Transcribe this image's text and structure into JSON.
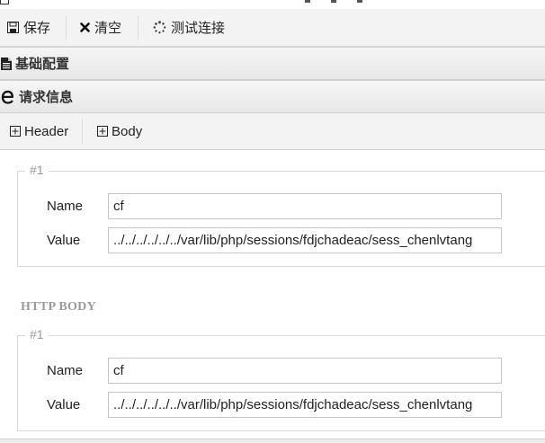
{
  "toolbar": {
    "save_label": "保存",
    "clear_label": "清空",
    "test_label": "测试连接",
    "save_icon": "save-icon",
    "clear_icon": "close-icon",
    "test_icon": "spinner-icon"
  },
  "sections": {
    "basic_config": {
      "label": "基础配置",
      "icon": "file-icon"
    },
    "request_info": {
      "label": "请求信息",
      "icon": "ie-icon"
    }
  },
  "tabs": [
    {
      "label": "Header",
      "icon": "plus-square-icon"
    },
    {
      "label": "Body",
      "icon": "plus-square-icon"
    }
  ],
  "header_group": {
    "legend": "#1",
    "name_label": "Name",
    "name_value": "cf",
    "value_label": "Value",
    "value_value": "../../../../../../var/lib/php/sessions/fdjchadeac/sess_chenlvtang"
  },
  "body_title": "HTTP BODY",
  "body_group": {
    "legend": "#1",
    "name_label": "Name",
    "name_value": "cf",
    "value_label": "Value",
    "value_value": "../../../../../../var/lib/php/sessions/fdjchadeac/sess_chenlvtang"
  }
}
